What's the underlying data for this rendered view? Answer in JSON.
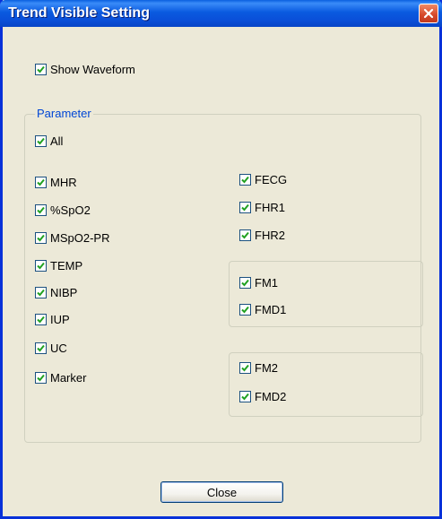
{
  "window": {
    "title": "Trend Visible Setting",
    "close_icon": "close-icon"
  },
  "colors": {
    "titlebar": "#0a5ae0",
    "window_bg": "#ece9d8",
    "check": "#21a121",
    "group_label": "#0046d5",
    "close_button": "#d5472a"
  },
  "show_waveform": {
    "label": "Show Waveform",
    "checked": true
  },
  "parameter_group": {
    "legend": "Parameter",
    "all": {
      "label": "All",
      "checked": true
    },
    "left_column": [
      {
        "label": "MHR",
        "checked": true
      },
      {
        "label": "%SpO2",
        "checked": true
      },
      {
        "label": "MSpO2-PR",
        "checked": true
      },
      {
        "label": "TEMP",
        "checked": true
      },
      {
        "label": "NIBP",
        "checked": true
      },
      {
        "label": "IUP",
        "checked": true
      },
      {
        "label": "UC",
        "checked": true
      },
      {
        "label": "Marker",
        "checked": true
      }
    ],
    "right_column": [
      {
        "label": "FECG",
        "checked": true
      },
      {
        "label": "FHR1",
        "checked": true
      },
      {
        "label": "FHR2",
        "checked": true
      }
    ],
    "fm_group_1": [
      {
        "label": "FM1",
        "checked": true
      },
      {
        "label": "FMD1",
        "checked": true
      }
    ],
    "fm_group_2": [
      {
        "label": "FM2",
        "checked": true
      },
      {
        "label": "FMD2",
        "checked": true
      }
    ]
  },
  "buttons": {
    "close_label": "Close"
  }
}
